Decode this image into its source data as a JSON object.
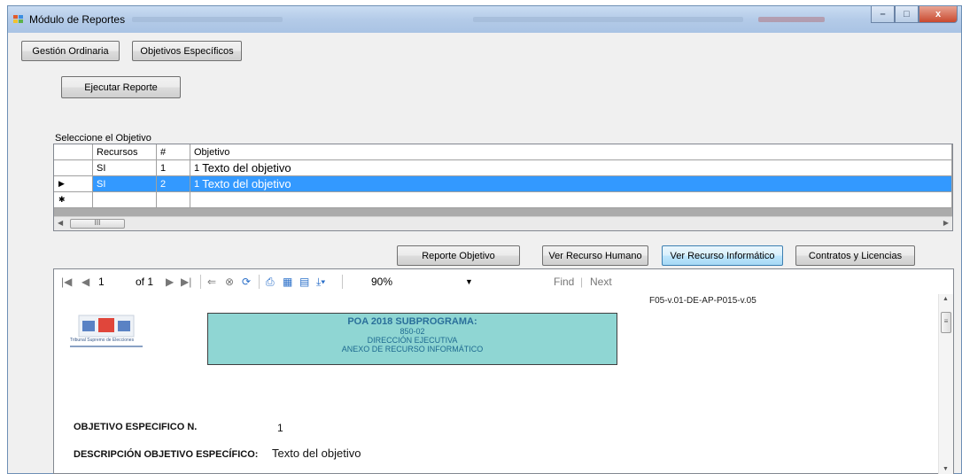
{
  "window": {
    "title": "Módulo de Reportes",
    "controls": {
      "minimize": "–",
      "maximize": "□",
      "close": "x"
    }
  },
  "tabs": [
    {
      "label": "Gestión Ordinaria"
    },
    {
      "label": "Objetivos Específicos"
    }
  ],
  "run_button": "Ejecutar Reporte",
  "grid": {
    "caption": "Seleccione el Objetivo",
    "columns": [
      "Recursos",
      "#",
      "Objetivo"
    ],
    "rows": [
      {
        "marker": "",
        "recursos": "SI",
        "num": "1",
        "obj_num": "1",
        "obj_text": "Texto del objetivo",
        "selected": false
      },
      {
        "marker": "▶",
        "recursos": "SI",
        "num": "2",
        "obj_num": "1",
        "obj_text": "Texto del objetivo",
        "selected": true
      },
      {
        "marker": "✱",
        "recursos": "",
        "num": "",
        "obj_num": "",
        "obj_text": "",
        "selected": false
      }
    ],
    "scroll_thumb": "III"
  },
  "actions": {
    "reporte_objetivo": "Reporte Objetivo",
    "ver_recurso_humano": "Ver Recurso Humano",
    "ver_recurso_informatico": "Ver Recurso Informático",
    "contratos_licencias": "Contratos y Licencias"
  },
  "viewer_toolbar": {
    "page": "1",
    "of_pages": "of 1",
    "zoom": "90%",
    "find": "Find",
    "next": "Next"
  },
  "report": {
    "form_code": "F05-v.01-DE-AP-P015-v.05",
    "header_title": "POA 2018 SUBPROGRAMA:",
    "header_code": "850-02",
    "header_dept": "DIRECCIÓN EJECUTIVA",
    "header_annex": "ANEXO DE RECURSO INFORMÁTICO",
    "logo_caption": "Tribunal Supremo de Elecciones",
    "objetivo_label": "OBJETIVO ESPECIFICO N.",
    "objetivo_value": "1",
    "descripcion_label": "DESCRIPCIÓN OBJETIVO ESPECÍFICO:",
    "descripcion_value": "Texto del objetivo"
  }
}
